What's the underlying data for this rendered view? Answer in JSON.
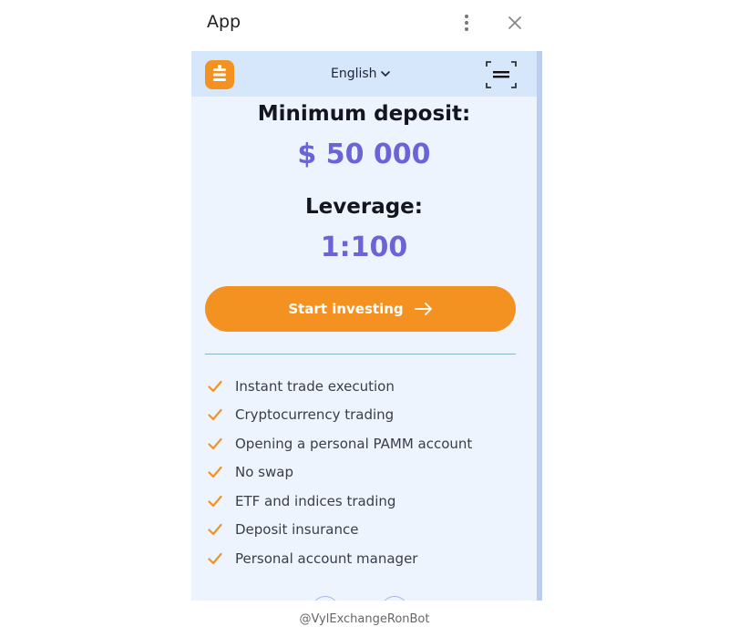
{
  "window": {
    "title": "App"
  },
  "header": {
    "language": "English"
  },
  "offer": {
    "min_deposit_label": "Minimum deposit:",
    "min_deposit_value": "$ 50 000",
    "leverage_label": "Leverage:",
    "leverage_value": "1:100"
  },
  "cta": {
    "label": "Start investing"
  },
  "features": [
    "Instant trade execution",
    "Cryptocurrency trading",
    "Opening a personal PAMM account",
    "No swap",
    "ETF and indices trading",
    "Deposit insurance",
    "Personal account manager"
  ],
  "footer": {
    "handle": "@VylExchangeRonBot"
  },
  "colors": {
    "accent_orange": "#f39220",
    "value_purple": "#6b64d8",
    "frame_bg": "#eef4fd",
    "header_bg": "#d6e6fb"
  },
  "icons": {
    "menu": "kebab-menu-icon",
    "close": "close-icon",
    "logo": "app-logo-icon",
    "language_chevron": "chevron-down-icon",
    "scan": "scan-icon",
    "arrow": "arrow-right-icon",
    "check": "check-icon"
  }
}
